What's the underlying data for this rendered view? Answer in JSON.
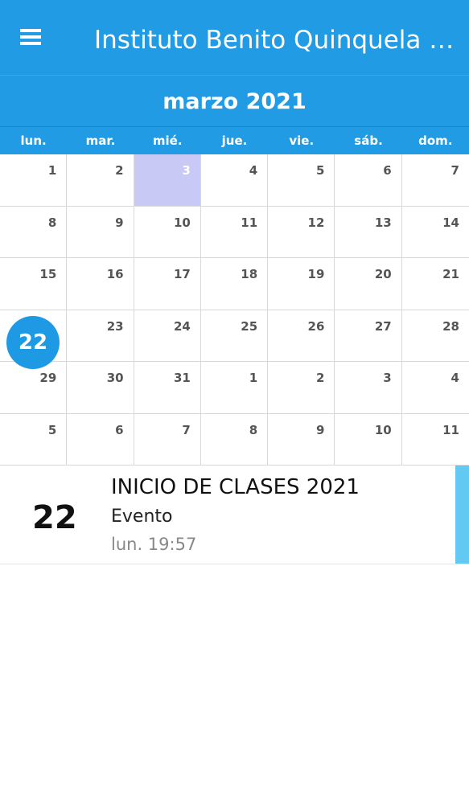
{
  "app": {
    "title": "Instituto Benito Quinquela Ma...",
    "menu_icon": "hamburger-menu-icon",
    "primary_color": "#229be5"
  },
  "calendar": {
    "month_label": "marzo 2021",
    "weekdays": [
      "lun.",
      "mar.",
      "mié.",
      "jue.",
      "vie.",
      "sáb.",
      "dom."
    ],
    "days": [
      "1",
      "2",
      "3",
      "4",
      "5",
      "6",
      "7",
      "8",
      "9",
      "10",
      "11",
      "12",
      "13",
      "14",
      "15",
      "16",
      "17",
      "18",
      "19",
      "20",
      "21",
      "22",
      "23",
      "24",
      "25",
      "26",
      "27",
      "28",
      "29",
      "30",
      "31",
      "1",
      "2",
      "3",
      "4",
      "5",
      "6",
      "7",
      "8",
      "9",
      "10",
      "11"
    ],
    "today_index": 2,
    "selected_index": 21,
    "selected_day": "22",
    "today_color": "#c9c9f5",
    "selected_color": "#1e9ae5"
  },
  "event": {
    "day": "22",
    "title": "INICIO DE CLASES 2021",
    "type": "Evento",
    "time": "lun. 19:57",
    "accent_color": "#62c9f2"
  }
}
